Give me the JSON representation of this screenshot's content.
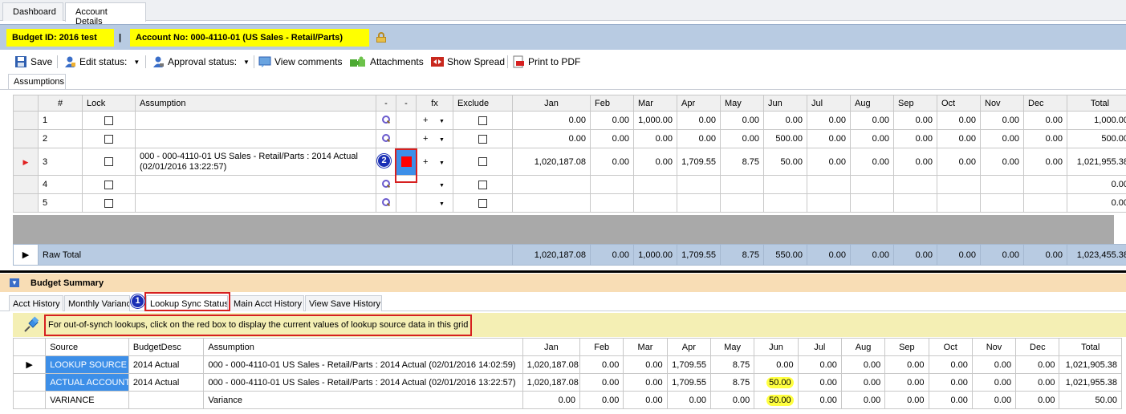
{
  "top_tabs": [
    "Dashboard",
    "Account Details"
  ],
  "header": {
    "budget_id": "Budget ID: 2016 test",
    "separator": "|",
    "account_no": "Account No: 000-4110-01 (US Sales - Retail/Parts)"
  },
  "toolbar": {
    "save": "Save",
    "edit_status": "Edit status:",
    "approval_status": "Approval status:",
    "view_comments": "View comments",
    "attachments": "Attachments",
    "show_spread": "Show Spread",
    "print_pdf": "Print to PDF"
  },
  "assumptions_tab": "Assumptions",
  "grid": {
    "headers": [
      "#",
      "Lock",
      "Assumption",
      "-",
      "-",
      "fx",
      "Exclude",
      "Jan",
      "Feb",
      "Mar",
      "Apr",
      "May",
      "Jun",
      "Jul",
      "Aug",
      "Sep",
      "Oct",
      "Nov",
      "Dec",
      "Total"
    ],
    "rows": [
      {
        "n": "1",
        "assumption": "",
        "fx": "+",
        "values": [
          "0.00",
          "0.00",
          "1,000.00",
          "0.00",
          "0.00",
          "0.00",
          "0.00",
          "0.00",
          "0.00",
          "0.00",
          "0.00",
          "0.00",
          "1,000.00"
        ]
      },
      {
        "n": "2",
        "assumption": "",
        "fx": "+",
        "values": [
          "0.00",
          "0.00",
          "0.00",
          "0.00",
          "0.00",
          "500.00",
          "0.00",
          "0.00",
          "0.00",
          "0.00",
          "0.00",
          "0.00",
          "500.00"
        ]
      },
      {
        "n": "3",
        "assumption": "000  -  000-4110-01 US Sales - Retail/Parts : 2014 Actual (02/01/2016 13:22:57)",
        "fx": "+",
        "values": [
          "1,020,187.08",
          "0.00",
          "0.00",
          "1,709.55",
          "8.75",
          "50.00",
          "0.00",
          "0.00",
          "0.00",
          "0.00",
          "0.00",
          "0.00",
          "1,021,955.38"
        ]
      },
      {
        "n": "4",
        "assumption": "",
        "fx": "",
        "values": [
          "",
          "",
          "",
          "",
          "",
          "",
          "",
          "",
          "",
          "",
          "",
          "",
          "0.00"
        ]
      },
      {
        "n": "5",
        "assumption": "",
        "fx": "",
        "values": [
          "",
          "",
          "",
          "",
          "",
          "",
          "",
          "",
          "",
          "",
          "",
          "",
          "0.00"
        ]
      }
    ],
    "raw_total": {
      "label": "Raw Total",
      "values": [
        "1,020,187.08",
        "0.00",
        "1,000.00",
        "1,709.55",
        "8.75",
        "550.00",
        "0.00",
        "0.00",
        "0.00",
        "0.00",
        "0.00",
        "0.00",
        "1,023,455.38"
      ]
    }
  },
  "summary": {
    "title": "Budget Summary",
    "tabs": [
      "Acct History",
      "Monthly Variance",
      "Lookup Sync Status",
      "Main Acct History",
      "View Save History"
    ],
    "badge1": "1",
    "badge2": "2",
    "info": "For out-of-synch lookups, click on the red box to display the current values of lookup source data in this grid",
    "headers": [
      "Source",
      "BudgetDesc",
      "Assumption",
      "Jan",
      "Feb",
      "Mar",
      "Apr",
      "May",
      "Jun",
      "Jul",
      "Aug",
      "Sep",
      "Oct",
      "Nov",
      "Dec",
      "Total"
    ],
    "rows": [
      {
        "source": "LOOKUP SOURCE",
        "desc": "2014 Actual",
        "assumption": "000  -  000-4110-01 US Sales - Retail/Parts : 2014 Actual (02/01/2016 14:02:59)",
        "values": [
          "1,020,187.08",
          "0.00",
          "0.00",
          "1,709.55",
          "8.75",
          "0.00",
          "0.00",
          "0.00",
          "0.00",
          "0.00",
          "0.00",
          "0.00",
          "1,021,905.38"
        ]
      },
      {
        "source": "ACTUAL ACCOUNT",
        "desc": "2014 Actual",
        "assumption": "000  -  000-4110-01 US Sales - Retail/Parts : 2014 Actual (02/01/2016 13:22:57)",
        "values": [
          "1,020,187.08",
          "0.00",
          "0.00",
          "1,709.55",
          "8.75",
          "50.00",
          "0.00",
          "0.00",
          "0.00",
          "0.00",
          "0.00",
          "0.00",
          "1,021,955.38"
        ]
      },
      {
        "source": "VARIANCE",
        "desc": "",
        "assumption": "Variance",
        "values": [
          "0.00",
          "0.00",
          "0.00",
          "0.00",
          "0.00",
          "50.00",
          "0.00",
          "0.00",
          "0.00",
          "0.00",
          "0.00",
          "0.00",
          "50.00"
        ]
      }
    ]
  },
  "colors": {
    "highlight": "#ffff00",
    "header_band": "#b8cbe2",
    "summary_bar": "#f8ddb5",
    "selected_cell": "#3d8fe8",
    "annotation": "#d62020"
  }
}
